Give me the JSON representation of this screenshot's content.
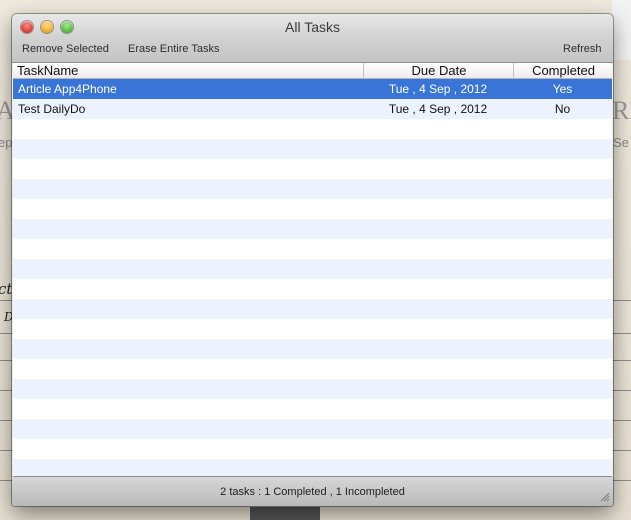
{
  "background_app": {
    "left_heading_fragment": "A",
    "left_sub_fragment": "ep",
    "right_heading_fragment": "RF",
    "right_sub_fragment": "Se",
    "left_hand_fragment_1": "ct",
    "left_hand_fragment_2": "D"
  },
  "window": {
    "title": "All Tasks",
    "toolbar": {
      "remove_label": "Remove Selected",
      "erase_label": "Erase Entire Tasks",
      "refresh_label": "Refresh"
    },
    "table": {
      "columns": [
        "TaskName",
        "Due Date",
        "Completed"
      ],
      "rows": [
        {
          "name": "Article App4Phone",
          "due": "Tue , 4 Sep , 2012",
          "completed": "Yes",
          "selected": true
        },
        {
          "name": "Test DailyDo",
          "due": "Tue , 4 Sep , 2012",
          "completed": "No",
          "selected": false
        }
      ]
    },
    "status": "2 tasks : 1 Completed , 1 Incompleted"
  },
  "colors": {
    "selection": "#3875d7",
    "stripe": "#edf3fe",
    "close": "#e0443e",
    "minimize": "#f2b02f",
    "zoom": "#5fbf45"
  }
}
